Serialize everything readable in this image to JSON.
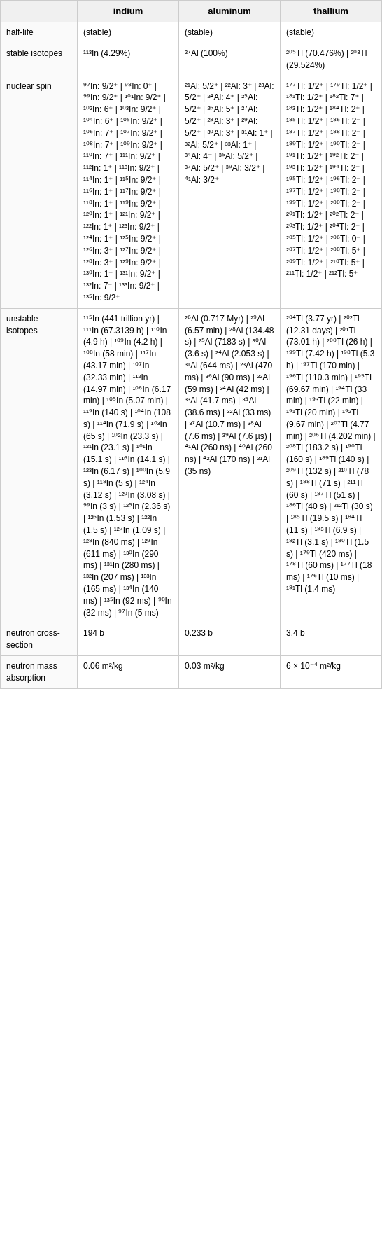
{
  "header": {
    "col1": "",
    "col2": "indium",
    "col3": "aluminum",
    "col4": "thallium"
  },
  "rows": [
    {
      "label": "half-life",
      "indium": "(stable)",
      "aluminum": "(stable)",
      "thallium": "(stable)"
    },
    {
      "label": "stable isotopes",
      "indium": "¹¹³In (4.29%)",
      "aluminum": "²⁷Al (100%)",
      "thallium": "²⁰⁵Tl (70.476%) | ²⁰³Tl (29.524%)"
    },
    {
      "label": "nuclear spin",
      "indium": "⁹⁷In: 9/2⁺ | ⁹⁸In: 0⁺ | ⁹⁹In: 9/2⁺ | ¹⁰¹In: 9/2⁺ | ¹⁰²In: 6⁺ | ¹⁰³In: 9/2⁺ | ¹⁰⁴In: 6⁺ | ¹⁰⁵In: 9/2⁺ | ¹⁰⁶In: 7⁺ | ¹⁰⁷In: 9/2⁺ | ¹⁰⁸In: 7⁺ | ¹⁰⁹In: 9/2⁺ | ¹¹⁰In: 7⁺ | ¹¹¹In: 9/2⁺ | ¹¹²In: 1⁺ | ¹¹³In: 9/2⁺ | ¹¹⁴In: 1⁺ | ¹¹⁵In: 9/2⁺ | ¹¹⁶In: 1⁺ | ¹¹⁷In: 9/2⁺ | ¹¹⁸In: 1⁺ | ¹¹⁹In: 9/2⁺ | ¹²⁰In: 1⁺ | ¹²¹In: 9/2⁺ | ¹²²In: 1⁺ | ¹²³In: 9/2⁺ | ¹²⁴In: 1⁺ | ¹²⁵In: 9/2⁺ | ¹²⁶In: 3⁺ | ¹²⁷In: 9/2⁺ | ¹²⁸In: 3⁺ | ¹²⁹In: 9/2⁺ | ¹³⁰In: 1⁻ | ¹³¹In: 9/2⁺ | ¹³²In: 7⁻ | ¹³³In: 9/2⁺ | ¹³⁵In: 9/2⁺",
      "aluminum": "²¹Al: 5/2⁺ | ²²Al: 3⁺ | ²³Al: 5/2⁺ | ²⁴Al: 4⁺ | ²⁵Al: 5/2⁺ | ²⁶Al: 5⁺ | ²⁷Al: 5/2⁺ | ²⁸Al: 3⁺ | ²⁹Al: 5/2⁺ | ³⁰Al: 3⁺ | ³¹Al: 1⁺ | ³²Al: 5/2⁺ | ³³Al: 1⁺ | ³⁴Al: 4⁻ | ³⁵Al: 5/2⁺ | ³⁷Al: 5/2⁺ | ³⁹Al: 3/2⁺ | ⁴¹Al: 3/2⁺",
      "thallium": "¹⁷⁷Tl: 1/2⁺ | ¹⁷⁹Tl: 1/2⁺ | ¹⁸¹Tl: 1/2⁺ | ¹⁸²Tl: 7⁺ | ¹⁸³Tl: 1/2⁺ | ¹⁸⁴Tl: 2⁺ | ¹⁸⁵Tl: 1/2⁺ | ¹⁸⁶Tl: 2⁻ | ¹⁸⁷Tl: 1/2⁺ | ¹⁸⁸Tl: 2⁻ | ¹⁸⁹Tl: 1/2⁺ | ¹⁹⁰Tl: 2⁻ | ¹⁹¹Tl: 1/2⁺ | ¹⁹²Tl: 2⁻ | ¹⁹³Tl: 1/2⁺ | ¹⁹⁴Tl: 2⁻ | ¹⁹⁵Tl: 1/2⁺ | ¹⁹⁶Tl: 2⁻ | ¹⁹⁷Tl: 1/2⁺ | ¹⁹⁸Tl: 2⁻ | ¹⁹⁹Tl: 1/2⁺ | ²⁰⁰Tl: 2⁻ | ²⁰¹Tl: 1/2⁺ | ²⁰²Tl: 2⁻ | ²⁰³Tl: 1/2⁺ | ²⁰⁴Tl: 2⁻ | ²⁰⁵Tl: 1/2⁺ | ²⁰⁶Tl: 0⁻ | ²⁰⁷Tl: 1/2⁺ | ²⁰⁸Tl: 5⁺ | ²⁰⁹Tl: 1/2⁺ | ²¹⁰Tl: 5⁺ | ²¹¹Tl: 1/2⁺ | ²¹²Tl: 5⁺"
    },
    {
      "label": "unstable isotopes",
      "indium": "¹¹⁵In (441 trillion yr) | ¹¹¹In (67.3139 h) | ¹¹⁰In (4.9 h) | ¹⁰⁹In (4.2 h) | ¹⁰⁸In (58 min) | ¹¹⁷In (43.17 min) | ¹⁰⁷In (32.33 min) | ¹¹²In (14.97 min) | ¹⁰⁶In (6.17 min) | ¹⁰⁵In (5.07 min) | ¹¹⁹In (140 s) | ¹⁰⁴In (108 s) | ¹¹⁴In (71.9 s) | ¹⁰³In (65 s) | ¹⁰²In (23.3 s) | ¹²¹In (23.1 s) | ¹⁰¹In (15.1 s) | ¹¹⁶In (14.1 s) | ¹²³In (6.17 s) | ¹⁰⁰In (5.9 s) | ¹¹⁸In (5 s) | ¹²⁴In (3.12 s) | ¹²⁰In (3.08 s) | ⁹⁹In (3 s) | ¹²⁵In (2.36 s) | ¹²⁶In (1.53 s) | ¹²²In (1.5 s) | ¹²⁷In (1.09 s) | ¹²⁸In (840 ms) | ¹²⁹In (611 ms) | ¹³⁰In (290 ms) | ¹³¹In (280 ms) | ¹³²In (207 ms) | ¹³³In (165 ms) | ¹³⁴In (140 ms) | ¹³⁵In (92 ms) | ⁹⁸In (32 ms) | ⁹⁷In (5 ms)",
      "aluminum": "²⁶Al (0.717 Myr) | ²⁹Al (6.57 min) | ²⁸Al (134.48 s) | ²⁵Al (7183 s) | ³⁰Al (3.6 s) | ²⁴Al (2.053 s) | ³¹Al (644 ms) | ²³Al (470 ms) | ³⁶Al (90 ms) | ²²Al (59 ms) | ³⁴Al (42 ms) | ³³Al (41.7 ms) | ³⁵Al (38.6 ms) | ³²Al (33 ms) | ³⁷Al (10.7 ms) | ³⁸Al (7.6 ms) | ³⁹Al (7.6 µs) | ⁴¹Al (260 ns) | ⁴⁰Al (260 ns) | ⁴²Al (170 ns) | ²¹Al (35 ns)",
      "thallium": "²⁰⁴Tl (3.77 yr) | ²⁰²Tl (12.31 days) | ²⁰¹Tl (73.01 h) | ²⁰⁰Tl (26 h) | ¹⁹⁹Tl (7.42 h) | ¹⁹⁸Tl (5.3 h) | ¹⁹⁷Tl (170 min) | ¹⁹⁶Tl (110.3 min) | ¹⁹⁵Tl (69.67 min) | ¹⁹⁴Tl (33 min) | ¹⁹³Tl (22 min) | ¹⁹¹Tl (20 min) | ¹⁹²Tl (9.67 min) | ²⁰⁷Tl (4.77 min) | ²⁰⁶Tl (4.202 min) | ²⁰⁸Tl (183.2 s) | ¹⁹⁰Tl (160 s) | ¹⁸⁹Tl (140 s) | ²⁰⁹Tl (132 s) | ²¹⁰Tl (78 s) | ¹⁸⁸Tl (71 s) | ²¹¹Tl (60 s) | ¹⁸⁷Tl (51 s) | ¹⁸⁶Tl (40 s) | ²¹²Tl (30 s) | ¹⁸⁵Tl (19.5 s) | ¹⁸⁴Tl (11 s) | ¹⁸³Tl (6.9 s) | ¹⁸²Tl (3.1 s) | ¹⁸⁰Tl (1.5 s) | ¹⁷⁹Tl (420 ms) | ¹⁷⁸Tl (60 ms) | ¹⁷⁷Tl (18 ms) | ¹⁷⁶Tl (10 ms) | ¹⁸¹Tl (1.4 ms)"
    },
    {
      "label": "neutron cross-section",
      "indium": "194 b",
      "aluminum": "0.233 b",
      "thallium": "3.4 b"
    },
    {
      "label": "neutron mass absorption",
      "indium": "0.06 m²/kg",
      "aluminum": "0.03 m²/kg",
      "thallium": "6 × 10⁻⁴ m²/kg"
    }
  ]
}
